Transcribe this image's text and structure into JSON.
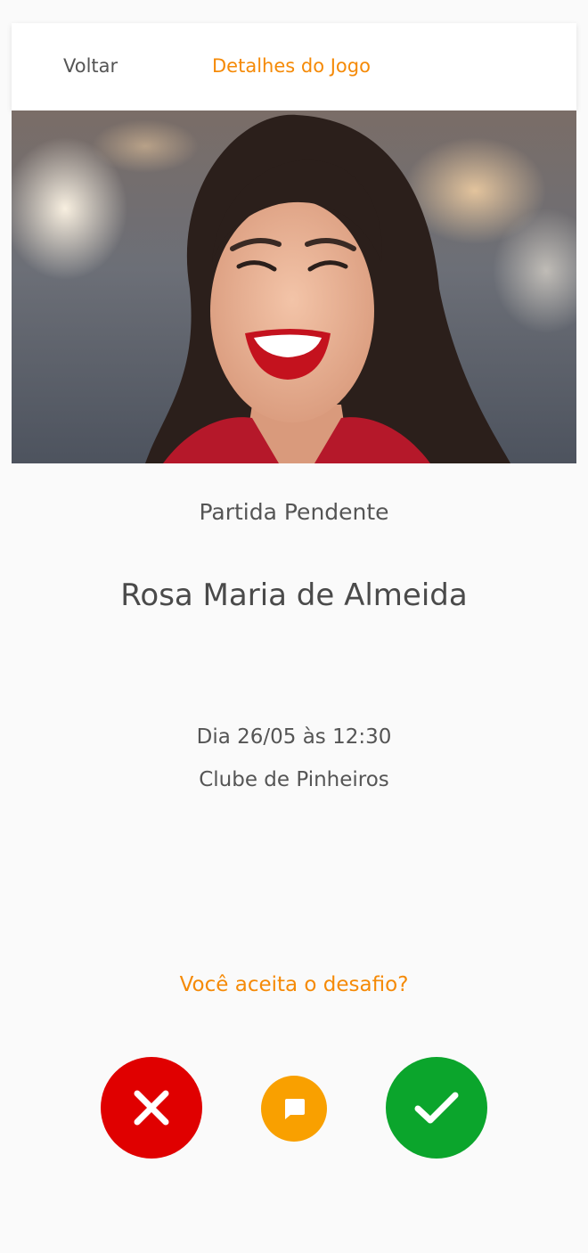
{
  "header": {
    "back_label": "Voltar",
    "title": "Detalhes do Jogo"
  },
  "match": {
    "status": "Partida Pendente",
    "opponent_name": "Rosa Maria de Almeida",
    "datetime": "Dia 26/05 às 12:30",
    "location": "Clube de Pinheiros"
  },
  "challenge": {
    "question": "Você aceita o desafio?"
  },
  "colors": {
    "accent": "#f58a07",
    "decline": "#e00000",
    "chat": "#f9a000",
    "accept": "#0ba52c"
  },
  "icons": {
    "decline": "close-icon",
    "chat": "chat-icon",
    "accept": "check-icon"
  }
}
